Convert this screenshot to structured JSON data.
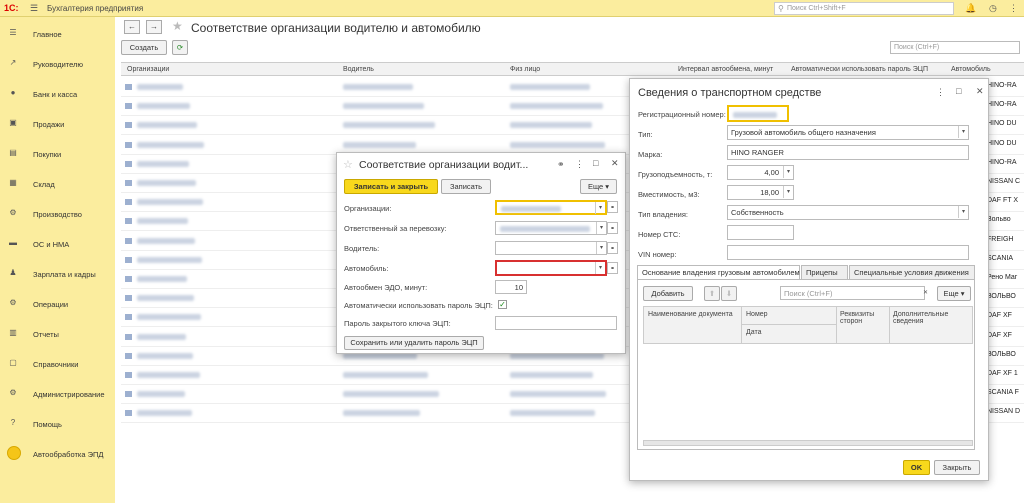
{
  "app": {
    "logo": "1С:",
    "title": "Бухгалтерия предприятия",
    "search_placeholder": "Поиск Ctrl+Shift+F"
  },
  "sidebar": {
    "items": [
      {
        "label": "Главное",
        "icon": "☰"
      },
      {
        "label": "Руководителю",
        "icon": "↗"
      },
      {
        "label": "Банк и касса",
        "icon": "●"
      },
      {
        "label": "Продажи",
        "icon": "▣"
      },
      {
        "label": "Покупки",
        "icon": "▤"
      },
      {
        "label": "Склад",
        "icon": "▦"
      },
      {
        "label": "Производство",
        "icon": "⚙"
      },
      {
        "label": "ОС и НМА",
        "icon": "▬"
      },
      {
        "label": "Зарплата и кадры",
        "icon": "♟"
      },
      {
        "label": "Операции",
        "icon": "⚙"
      },
      {
        "label": "Отчеты",
        "icon": "▥"
      },
      {
        "label": "Справочники",
        "icon": "▢"
      },
      {
        "label": "Администрирование",
        "icon": "⚙"
      },
      {
        "label": "Помощь",
        "icon": "?"
      },
      {
        "label": "Автообработка ЭПД",
        "icon": ""
      }
    ]
  },
  "page": {
    "title": "Соответствие организации водителю и автомобилю",
    "create_label": "Создать",
    "search_placeholder": "Поиск (Ctrl+F)"
  },
  "list": {
    "columns": [
      "Организации",
      "Водитель",
      "Физ лицо",
      "Интервал автообмена, минут",
      "Автоматически использовать пароль ЭЦП",
      "Автомобиль"
    ],
    "vehicles": [
      "HINO-RA",
      "HINO-RA",
      "HINO DU",
      "HINO DU",
      "HINO-RA",
      "NISSAN C",
      "DAF FT X",
      "Вольво",
      "FREIGH",
      "SCANIA",
      "Рено Маг",
      "ВОЛЬВО",
      "DAF XF",
      "DAF XF",
      "ВОЛЬВО",
      "DAF XF 1",
      "SCANIA F",
      "NISSAN D"
    ]
  },
  "dialog1": {
    "title": "Соответствие организации водит...",
    "save_close": "Записать и закрыть",
    "save": "Записать",
    "more": "Еще",
    "fields": {
      "org": "Организации:",
      "resp": "Ответственный за перевозку:",
      "driver": "Водитель:",
      "car": "Автомобиль:",
      "edo": "Автообмен ЭДО, минут:",
      "autopass": "Автоматически использовать пароль ЭЦП:",
      "keypass": "Пароль закрытого ключа ЭЦП:"
    },
    "edo_value": "10",
    "save_pass_label": "Сохранить или удалить пароль ЭЦП"
  },
  "dialog2": {
    "title": "Сведения о транспортном средстве",
    "labels": {
      "reg": "Регистрационный номер:",
      "type": "Тип:",
      "brand": "Марка:",
      "capacity": "Грузоподъемность, т:",
      "volume": "Вместимость, м3:",
      "ownership": "Тип владения:",
      "sts": "Номер СТС:",
      "vin": "VIN номер:"
    },
    "values": {
      "type": "Грузовой автомобиль общего назначения",
      "brand": "HINO RANGER",
      "capacity": "4,00",
      "volume": "18,00",
      "ownership": "Собственность"
    },
    "tabs": [
      "Основание владения грузовым автомобилем",
      "Прицепы",
      "Специальные условия движения"
    ],
    "add_label": "Добавить",
    "search_placeholder": "Поиск (Ctrl+F)",
    "more": "Еще",
    "grid": {
      "c1": "Наименование документа",
      "c2": "Номер",
      "c2b": "Дата",
      "c3": "Реквизиты сторон",
      "c4": "Дополнительные сведения"
    },
    "ok": "OK",
    "close": "Закрыть"
  }
}
